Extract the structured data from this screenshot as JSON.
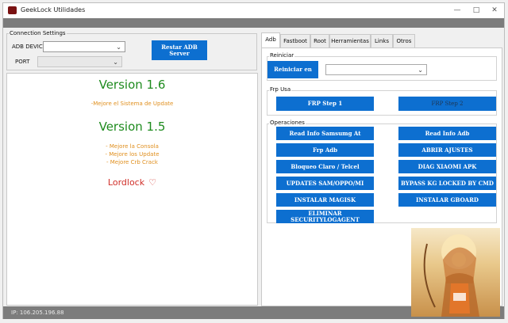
{
  "window": {
    "title": "GeekLock Utilidades",
    "minimize": "—",
    "maximize": "□",
    "close": "✕"
  },
  "connection": {
    "group_label": "Connection Settings",
    "adb_label": "ADB DEVICE",
    "adb_value": "",
    "port_label": "PORT",
    "port_value": "",
    "restart_button": "Restar ADB Server"
  },
  "log": {
    "version1": "Version 1.6",
    "notes1": [
      "-Mejore el Sistema de Update"
    ],
    "version2": "Version 1.5",
    "notes2": [
      "- Mejore la Consola",
      "- Mejore los Update",
      "- Mejore Crb Crack"
    ],
    "brand": "Lordlock"
  },
  "tabs": [
    "Adb",
    "Fastboot",
    "Root",
    "Herramientas",
    "Links",
    "Otros"
  ],
  "reiniciar": {
    "label": "Reiniciar",
    "button": "Reiniciar en",
    "select_value": ""
  },
  "frp_usa": {
    "label": "Frp Usa",
    "step1": "FRP Step 1",
    "step2": "FRP Step 2"
  },
  "operaciones": {
    "label": "Operaciones",
    "left": [
      "Read Info Samsumg At",
      "Frp Adb",
      "Bloqueo Claro / Telcel",
      "UPDATES SAM/OPPO/MI",
      "INSTALAR MAGISK",
      "ELIMINAR SECURITYLOGAGENT"
    ],
    "right": [
      "Read Info Adb",
      "ABRIR AJUSTES",
      "DIAG XIAOMI APK",
      "BYPASS KG LOCKED BY CMD",
      "INSTALAR GBOARD"
    ]
  },
  "status": {
    "ip": "IP: 106.205.196.88"
  },
  "colors": {
    "button": "#0d6fd0",
    "version": "#1e8b1e",
    "note": "#e09020",
    "brand": "#d0302a",
    "statusbar": "#7c7c7c"
  }
}
